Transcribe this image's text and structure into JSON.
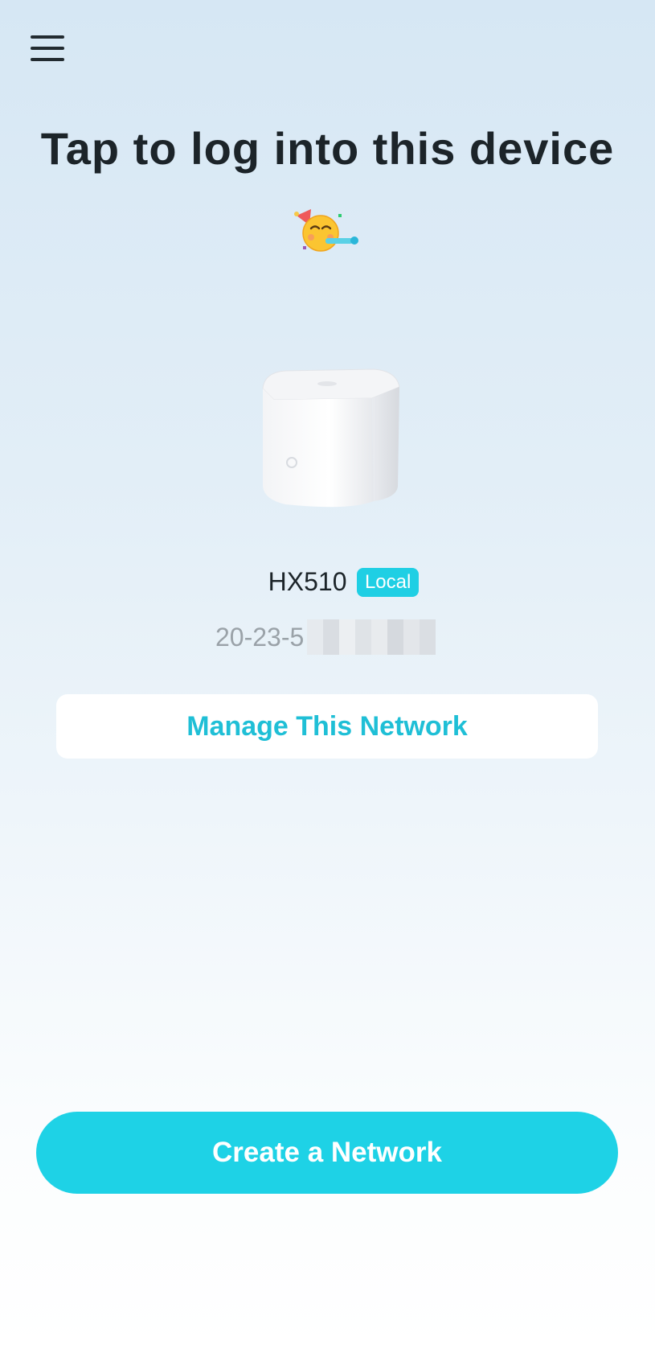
{
  "header": {
    "menu_icon": "hamburger-menu-icon"
  },
  "title": "Tap to log into this device",
  "title_emoji": "partying-face-icon",
  "device": {
    "image": "mesh-router-device",
    "name": "HX510",
    "badge": "Local",
    "mac_prefix": "20-23-5",
    "mac_rest_obscured": true
  },
  "buttons": {
    "manage_label": "Manage This Network",
    "create_label": "Create a Network"
  },
  "colors": {
    "accent": "#1ed2e6",
    "manage_text": "#1fbfd6",
    "badge_bg": "#1fcfe4"
  }
}
